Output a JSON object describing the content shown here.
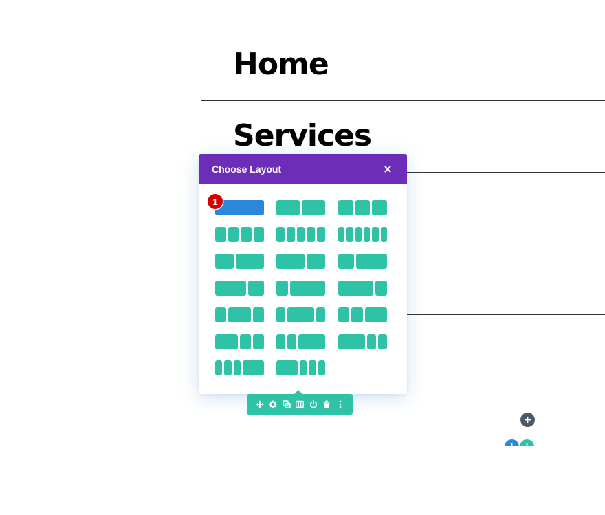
{
  "page": {
    "headings": [
      "Home",
      "Services"
    ]
  },
  "modal": {
    "title": "Choose Layout",
    "close_icon": "close-icon",
    "selected_layout": "1 column",
    "badge": "1",
    "colors": {
      "header": "#6c2eb9",
      "option": "#2ec3a7",
      "selected": "#2b87da",
      "badge": "#d40000"
    }
  },
  "layouts": [
    {
      "name": "1 column",
      "cols": [
        1
      ]
    },
    {
      "name": "1/2 + 1/2",
      "cols": [
        1,
        1
      ]
    },
    {
      "name": "1/3 + 1/3 + 1/3",
      "cols": [
        1,
        1,
        1
      ]
    },
    {
      "name": "1/4 x 4",
      "cols": [
        1,
        1,
        1,
        1
      ]
    },
    {
      "name": "1/5 x 5",
      "cols": [
        1,
        1,
        1,
        1,
        1
      ]
    },
    {
      "name": "1/6 x 6",
      "cols": [
        1,
        1,
        1,
        1,
        1,
        1
      ]
    },
    {
      "name": "2/5 + 3/5",
      "cols": [
        2,
        3
      ]
    },
    {
      "name": "3/5 + 2/5",
      "cols": [
        3,
        2
      ]
    },
    {
      "name": "1/3 + 2/3",
      "cols": [
        1,
        2
      ]
    },
    {
      "name": "2/3 + 1/3",
      "cols": [
        2,
        1
      ]
    },
    {
      "name": "1/4 + 3/4",
      "cols": [
        1,
        3
      ]
    },
    {
      "name": "3/4 + 1/4",
      "cols": [
        3,
        1
      ]
    },
    {
      "name": "1/4 + 1/2 + 1/4",
      "cols": [
        1,
        2,
        1
      ]
    },
    {
      "name": "1/5 + 3/5 + 1/5",
      "cols": [
        1,
        3,
        1
      ]
    },
    {
      "name": "1/4 + 1/4 + 1/2",
      "cols": [
        1,
        1,
        2
      ]
    },
    {
      "name": "1/2 + 1/4 + 1/4",
      "cols": [
        2,
        1,
        1
      ]
    },
    {
      "name": "1/5 + 1/5 + 3/5",
      "cols": [
        1,
        1,
        3
      ]
    },
    {
      "name": "3/5 + 1/5 + 1/5",
      "cols": [
        3,
        1,
        1
      ]
    },
    {
      "name": "1/6 + 1/6 + 1/6 + 1/2",
      "cols": [
        1,
        1,
        1,
        3
      ]
    },
    {
      "name": "1/2 + 1/6 + 1/6 + 1/6",
      "cols": [
        3,
        1,
        1,
        1
      ]
    }
  ],
  "toolbar": {
    "icons": [
      "move-icon",
      "settings-gear-icon",
      "duplicate-icon",
      "columns-layout-icon",
      "power-toggle-icon",
      "trash-icon",
      "more-options-icon"
    ],
    "color": "#2ec3a7"
  },
  "add_buttons": [
    {
      "name": "add-section-button",
      "icon": "plus-icon",
      "color": "#4c5866"
    },
    {
      "name": "add-module-button",
      "icon": "plus-icon",
      "color": "#2b87da"
    },
    {
      "name": "add-row-button",
      "icon": "plus-icon",
      "color": "#2ec3a7"
    }
  ]
}
